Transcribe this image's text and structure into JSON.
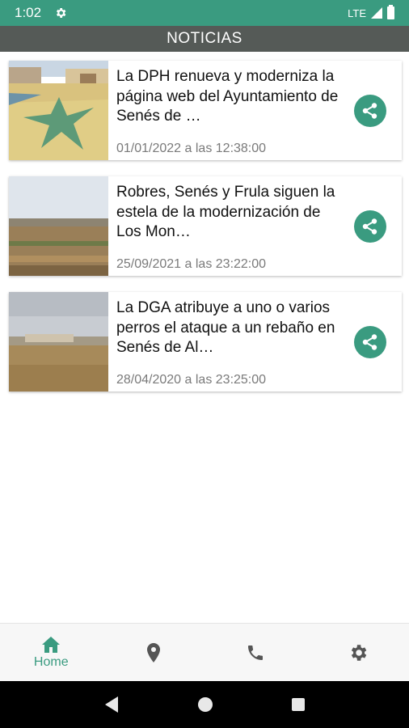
{
  "status_bar": {
    "time": "1:02",
    "network": "LTE"
  },
  "app_bar": {
    "title": "NOTICIAS"
  },
  "news": [
    {
      "title": "La DPH renueva y moderniza la página web del Ayuntamiento de Senés de …",
      "date": "01/01/2022 a las 12:38:00"
    },
    {
      "title": "Robres, Senés y Frula siguen la estela de la modernización de Los Mon…",
      "date": "25/09/2021 a las 23:22:00"
    },
    {
      "title": "La DGA atribuye a uno o varios perros el ataque a un rebaño en Senés de Al…",
      "date": "28/04/2020 a las 23:25:00"
    }
  ],
  "bottom_nav": {
    "home_label": "Home"
  },
  "colors": {
    "accent": "#3a9b80",
    "app_bar": "#555a57",
    "status_bar": "#3a9b80"
  }
}
